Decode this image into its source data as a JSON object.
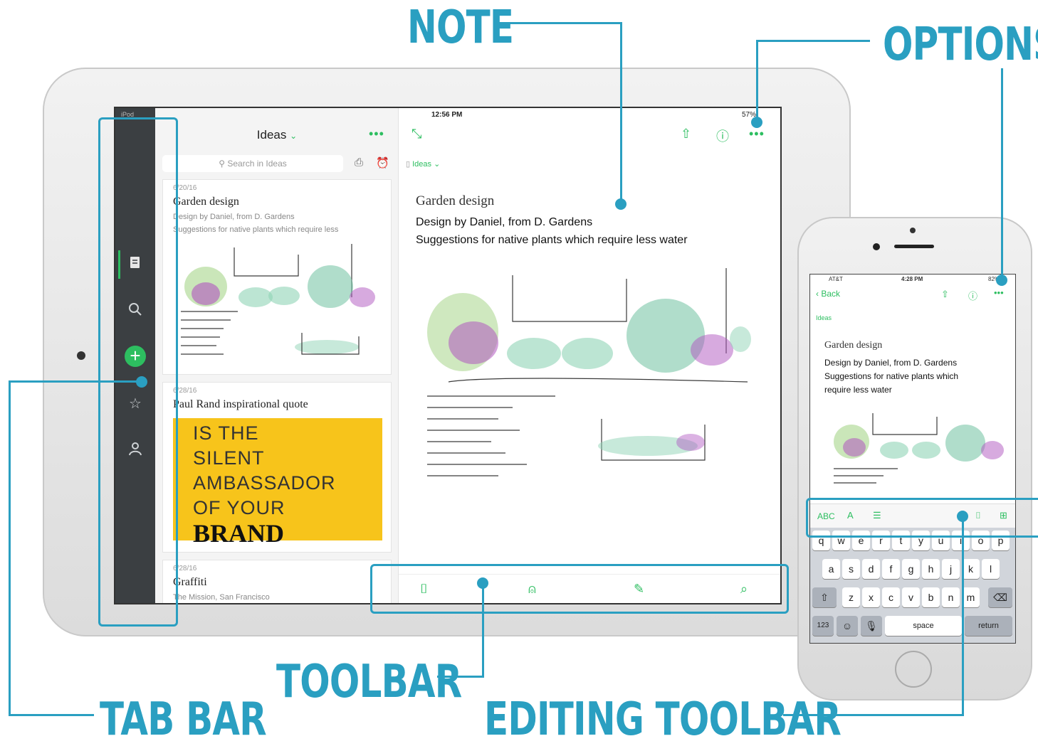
{
  "callouts": {
    "note": "NOTE",
    "options": "OPTIONS",
    "toolbar": "TOOLBAR",
    "tab_bar": "TAB BAR",
    "editing_toolbar": "EDITING TOOLBAR"
  },
  "accent_color": "#2a9fc1",
  "app_green": "#2dbe60",
  "ipad": {
    "status": {
      "carrier": "iPod",
      "time": "12:56 PM",
      "battery": "57%"
    },
    "notebook_title": "Ideas",
    "search_placeholder": "Search in Ideas",
    "notes": [
      {
        "date": "6/20/16",
        "title": "Garden design",
        "line1": "Design by Daniel, from D. Gardens",
        "line2": "Suggestions for native plants which require less"
      },
      {
        "date": "6/28/16",
        "title": "Paul Rand inspirational quote",
        "quote": [
          "IS THE",
          "SILENT",
          "AMBASSADOR",
          "OF YOUR"
        ],
        "quote_last": "BRAND"
      },
      {
        "date": "6/28/16",
        "title": "Graffiti",
        "line1": "The Mission, San Francisco"
      }
    ],
    "note": {
      "notebook": "Ideas",
      "title": "Garden design",
      "line1": "Design by Daniel, from D. Gardens",
      "line2": "Suggestions for native plants which require less water"
    },
    "tabbar_icons": [
      "notes-icon",
      "search-icon",
      "add-icon",
      "star-icon",
      "person-icon"
    ],
    "toolbar_icons": [
      "camera-icon",
      "voice-icon",
      "handwriting-icon",
      "attachment-icon"
    ]
  },
  "iphone": {
    "status": {
      "carrier": "AT&T",
      "time": "4:28 PM",
      "battery": "82%"
    },
    "back": "Back",
    "notebook": "Ideas",
    "note_title": "Garden design",
    "note_line1": "Design by Daniel, from D. Gardens",
    "note_line2": "Suggestions for native plants which",
    "note_line3": "require less water",
    "edit_abc": "ABC",
    "keys_row1": [
      "q",
      "w",
      "e",
      "r",
      "t",
      "y",
      "u",
      "i",
      "o",
      "p"
    ],
    "keys_row2": [
      "a",
      "s",
      "d",
      "f",
      "g",
      "h",
      "j",
      "k",
      "l"
    ],
    "keys_row3": [
      "z",
      "x",
      "c",
      "v",
      "b",
      "n",
      "m"
    ],
    "key_123": "123",
    "key_space": "space",
    "key_return": "return"
  }
}
